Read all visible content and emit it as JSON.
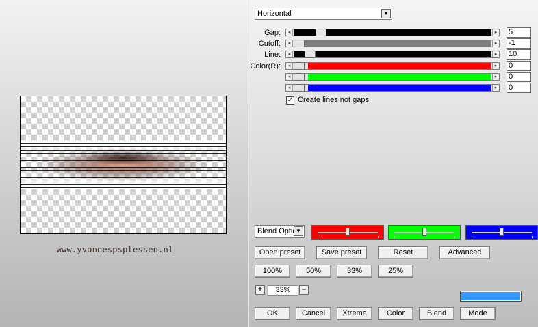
{
  "preview": {
    "watermark": "www.yvonnespsplessen.nl"
  },
  "direction": {
    "value": "Horizontal"
  },
  "sliders": [
    {
      "label": "Gap:",
      "value": "5",
      "color": "#000000"
    },
    {
      "label": "Cutoff:",
      "value": "-1",
      "color": "#808080"
    },
    {
      "label": "Line:",
      "value": "10",
      "color": "#000000"
    },
    {
      "label": "Color(R):",
      "value": "0",
      "color": "#ff0000"
    },
    {
      "label": "",
      "value": "0",
      "color": "#00ff00"
    },
    {
      "label": "",
      "value": "0",
      "color": "#0000ff"
    }
  ],
  "options": {
    "create_lines_label": "Create lines not gaps",
    "create_lines_checked": "✓"
  },
  "blend": {
    "value": "Blend Optio",
    "strips": [
      "#ff0000",
      "#00ff00",
      "#0000ff"
    ]
  },
  "buttons": {
    "open_preset": "Open preset",
    "save_preset": "Save preset",
    "reset": "Reset",
    "advanced": "Advanced",
    "z100": "100%",
    "z50": "50%",
    "z33": "33%",
    "z25": "25%",
    "ok": "OK",
    "cancel": "Cancel",
    "xtreme": "Xtreme",
    "color": "Color",
    "blend": "Blend",
    "mode": "Mode"
  },
  "zoom": {
    "plus": "+",
    "value": "33%",
    "minus": "–"
  },
  "swatch_color": "#3399ff"
}
